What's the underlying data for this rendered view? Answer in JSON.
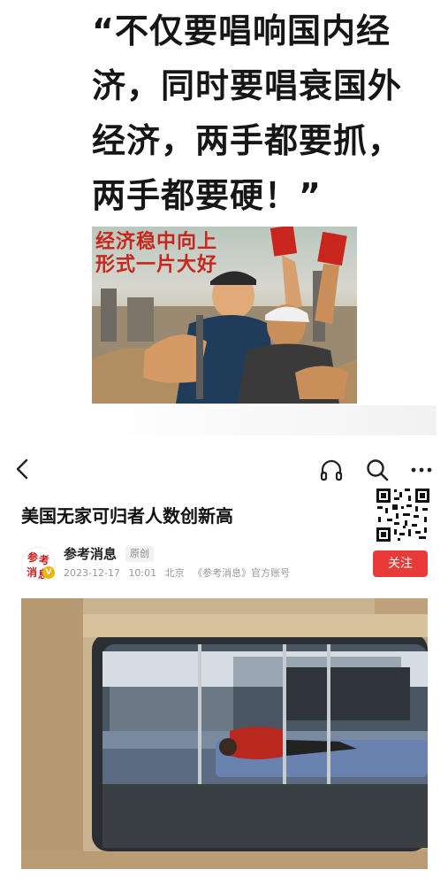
{
  "quote": {
    "lines": [
      "“不仅要唱响国内经",
      "济，同时要唱衰国外",
      "经济，两手都要抓，",
      "两手都要硬！”"
    ]
  },
  "poster": {
    "slogan_line1": "经济稳中向上",
    "slogan_line2": "形式一片大好"
  },
  "nav": {
    "back_icon": "chevron-left-icon",
    "headphone_icon": "headphone-icon",
    "search_icon": "search-icon",
    "more_icon": "more-dots-icon"
  },
  "article": {
    "title": "美国无家可归者人数创新高",
    "author": "参考消息",
    "original_tag": "原创",
    "date": "2023-12-17",
    "time": "10:01",
    "location": "北京",
    "source": "《参考消息》官方账号",
    "follow_label": "关注",
    "avatar_chars": [
      "参",
      "考",
      "消",
      "息"
    ]
  },
  "colors": {
    "accent_red": "#e93a3a",
    "slogan_red": "#c8261c",
    "badge_yellow": "#f0b400"
  }
}
